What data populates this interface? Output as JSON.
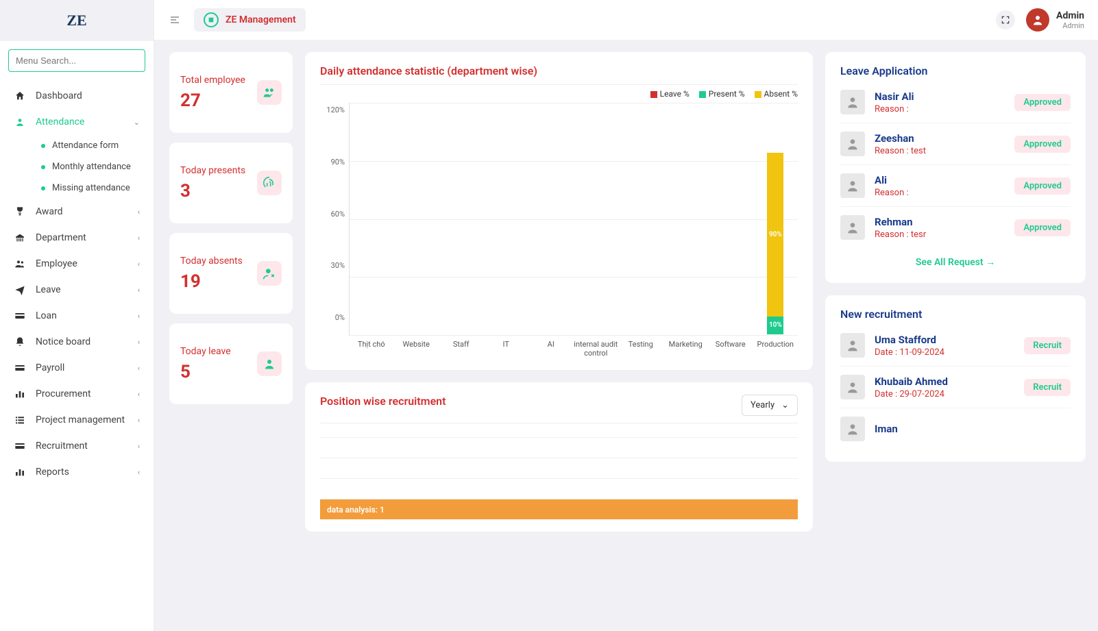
{
  "brand": "ZE",
  "brand_chip": "ZE Management",
  "search_placeholder": "Menu Search...",
  "user": {
    "name": "Admin",
    "role": "Admin"
  },
  "nav": {
    "dashboard": "Dashboard",
    "attendance": "Attendance",
    "attendance_sub": [
      "Attendance form",
      "Monthly attendance",
      "Missing attendance"
    ],
    "award": "Award",
    "department": "Department",
    "employee": "Employee",
    "leave": "Leave",
    "loan": "Loan",
    "notice": "Notice board",
    "payroll": "Payroll",
    "procurement": "Procurement",
    "project": "Project management",
    "recruitment": "Recruitment",
    "reports": "Reports"
  },
  "stats": [
    {
      "label": "Total employee",
      "value": "27"
    },
    {
      "label": "Today presents",
      "value": "3"
    },
    {
      "label": "Today absents",
      "value": "19"
    },
    {
      "label": "Today leave",
      "value": "5"
    }
  ],
  "attendance_chart_title": "Daily attendance statistic (department wise)",
  "legend": {
    "leave": "Leave %",
    "present": "Present %",
    "absent": "Absent %"
  },
  "chart_colors": {
    "leave": "#d32f2f",
    "present": "#1ecb8f",
    "absent": "#f1c40f"
  },
  "chart_data": {
    "type": "bar",
    "title": "Daily attendance statistic (department wise)",
    "xlabel": "",
    "ylabel": "",
    "ylim": [
      0,
      120
    ],
    "yticks": [
      "120%",
      "90%",
      "60%",
      "30%",
      "0%"
    ],
    "categories": [
      "Thịt chó",
      "Website",
      "Staff",
      "IT",
      "AI",
      "internal audit control",
      "Testing",
      "Marketing",
      "Software",
      "Production"
    ],
    "series": [
      {
        "name": "Leave %",
        "color": "#d32f2f",
        "values": [
          0,
          0,
          0,
          0,
          0,
          0,
          0,
          0,
          0,
          0
        ]
      },
      {
        "name": "Present %",
        "color": "#1ecb8f",
        "values": [
          0,
          0,
          0,
          0,
          0,
          0,
          0,
          0,
          0,
          10
        ]
      },
      {
        "name": "Absent %",
        "color": "#f1c40f",
        "values": [
          0,
          0,
          0,
          0,
          0,
          0,
          0,
          0,
          0,
          90
        ]
      }
    ]
  },
  "recruit_chart": {
    "title": "Position wise recruitment",
    "period_selected": "Yearly",
    "bars": [
      {
        "label": "data analysis: 1",
        "value": 1
      }
    ]
  },
  "leave_panel": {
    "title": "Leave Application",
    "see_all": "See All Request →",
    "status_label": "Approved",
    "items": [
      {
        "name": "Nasir Ali",
        "reason": "Reason :"
      },
      {
        "name": "Zeeshan",
        "reason": "Reason : test"
      },
      {
        "name": "Ali",
        "reason": "Reason :"
      },
      {
        "name": "Rehman",
        "reason": "Reason : tesr"
      }
    ]
  },
  "new_recruitment": {
    "title": "New recruitment",
    "button_label": "Recruit",
    "items": [
      {
        "name": "Uma Stafford",
        "date": "Date : 11-09-2024"
      },
      {
        "name": "Khubaib Ahmed",
        "date": "Date : 29-07-2024"
      },
      {
        "name": "Iman",
        "date": ""
      }
    ]
  }
}
